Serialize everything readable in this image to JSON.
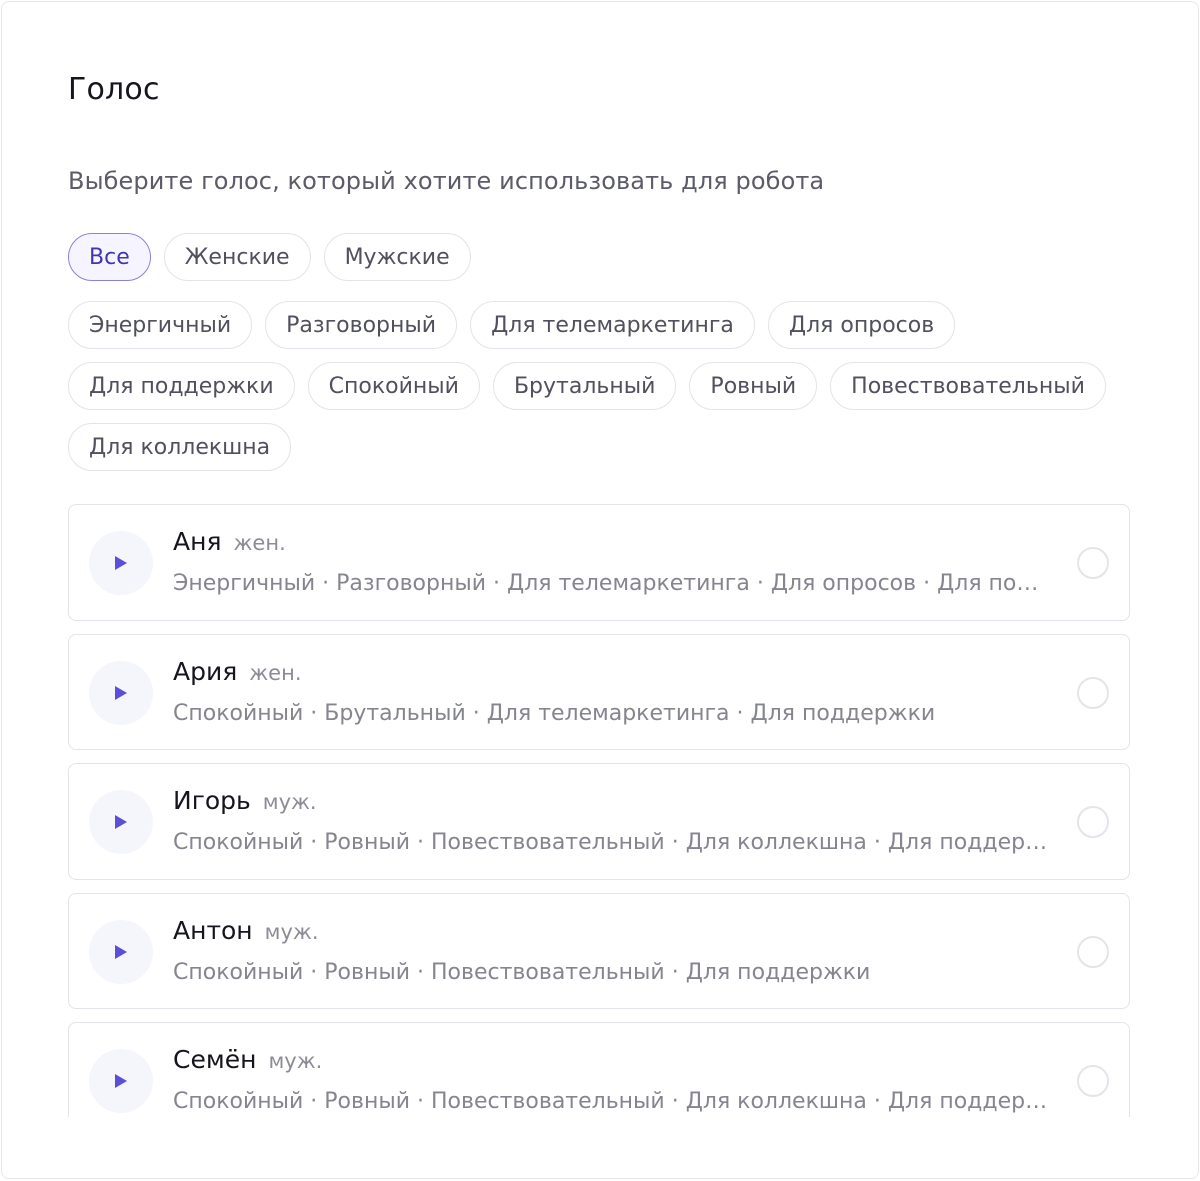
{
  "title": "Голос",
  "subtitle": "Выберите голос, который хотите использовать для робота",
  "gender_filters": [
    {
      "label": "Все",
      "active": true
    },
    {
      "label": "Женские",
      "active": false
    },
    {
      "label": "Мужские",
      "active": false
    }
  ],
  "tag_filters": [
    "Энергичный",
    "Разговорный",
    "Для телемаркетинга",
    "Для опросов",
    "Для поддержки",
    "Спокойный",
    "Брутальный",
    "Ровный",
    "Повествовательный",
    "Для коллекшна"
  ],
  "voices": [
    {
      "name": "Аня",
      "gender": "жен.",
      "tags": "Энергичный · Разговорный · Для телемаркетинга · Для опросов · Для поддержки"
    },
    {
      "name": "Ария",
      "gender": "жен.",
      "tags": "Спокойный · Брутальный · Для телемаркетинга · Для поддержки"
    },
    {
      "name": "Игорь",
      "gender": "муж.",
      "tags": "Спокойный · Ровный · Повествовательный · Для коллекшна · Для поддержки"
    },
    {
      "name": "Антон",
      "gender": "муж.",
      "tags": "Спокойный · Ровный · Повествовательный · Для поддержки"
    },
    {
      "name": "Семён",
      "gender": "муж.",
      "tags": "Спокойный · Ровный · Повествовательный · Для коллекшна · Для поддержки"
    }
  ],
  "colors": {
    "accent": "#4134b5",
    "play_icon": "#5a4fd6"
  },
  "icons": {
    "play": "play-icon",
    "radio": "radio-button"
  }
}
